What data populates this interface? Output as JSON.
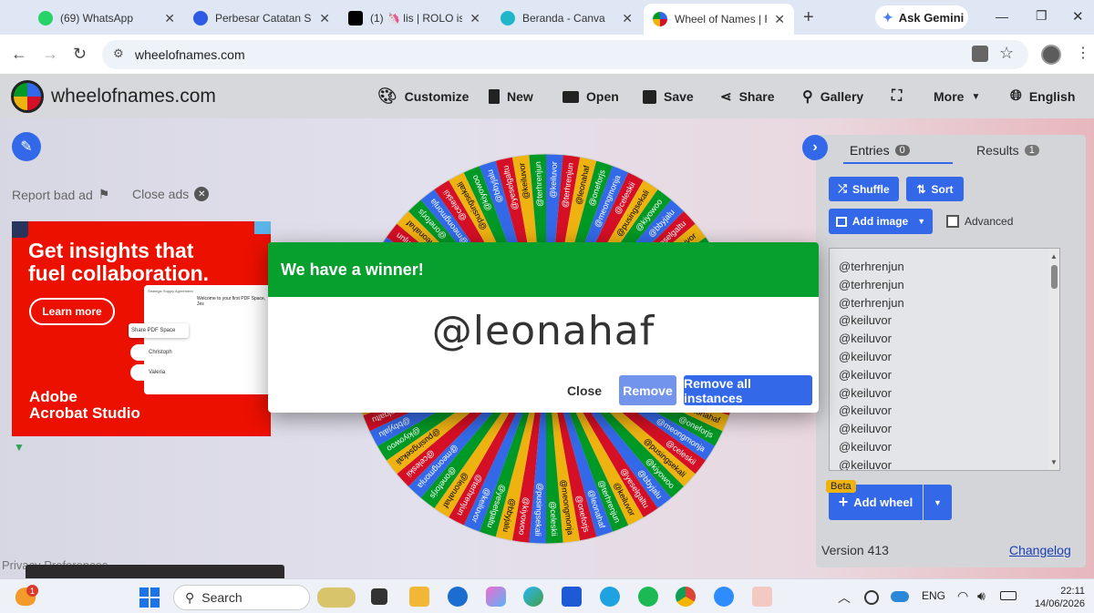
{
  "browser": {
    "tabs": [
      {
        "label": "(69) WhatsApp",
        "color": "#25d366"
      },
      {
        "label": "Perbesar Catatan Sa",
        "color": "#2d5be3"
      },
      {
        "label": "(1) 🦄 lis | ROLO is r",
        "color": "#000000"
      },
      {
        "label": "Beranda - Canva",
        "color": "#1fb6c9"
      },
      {
        "label": "Wheel of Names | R",
        "color": "#e8453c"
      }
    ],
    "new_tab": "+",
    "ask_gemini": "Ask Gemini",
    "url": "wheelofnames.com"
  },
  "site": {
    "logo_text": "wheelofnames.com",
    "menu": [
      "Customize",
      "New",
      "Open",
      "Save",
      "Share",
      "Gallery",
      "More",
      "English"
    ]
  },
  "ad": {
    "report": "Report bad ad",
    "close": "Close ads",
    "headline": "Get insights that fuel collaboration.",
    "cta": "Learn more",
    "brand_line1": "Adobe",
    "brand_line2": "Acrobat Studio",
    "doc_title": "Strategic Supply Agreement",
    "doc_heading": "Welcome to your first PDF Space, Jes",
    "share_label": "Share PDF Space",
    "person1": "Christoph",
    "person2": "Valeria",
    "privacy": "Privacy Preferences"
  },
  "wheel": {
    "segment_colors": [
      "#3369e8",
      "#d50f25",
      "#eeb211",
      "#009925"
    ],
    "labels": [
      "@keiluvor",
      "@terhrenjun",
      "@leonahaf",
      "@oneforjs",
      "@meongmonja",
      "@celeskii",
      "@pusingsekali",
      "@kiyowoo",
      "@bbyjalu",
      "@yeselgaltu"
    ]
  },
  "panel": {
    "entries_tab": "Entries",
    "entries_count": "0",
    "results_tab": "Results",
    "results_count": "1",
    "shuffle": "Shuffle",
    "sort": "Sort",
    "add_image": "Add image",
    "advanced": "Advanced",
    "entries": [
      "@terhrenjun",
      "@terhrenjun",
      "@terhrenjun",
      "@keiluvor",
      "@keiluvor",
      "@keiluvor",
      "@keiluvor",
      "@keiluvor",
      "@keiluvor",
      "@keiluvor",
      "@keiluvor",
      "@keiluvor"
    ],
    "beta": "Beta",
    "add_wheel": "Add wheel",
    "version": "Version 413",
    "changelog": "Changelog"
  },
  "modal": {
    "title": "We have a winner!",
    "winner": "@leonahaf",
    "close": "Close",
    "remove": "Remove",
    "remove_all": "Remove all instances"
  },
  "taskbar": {
    "search": "Search",
    "badge": "1",
    "lang": "ENG",
    "time": "22:11",
    "date": "14/06/2026"
  }
}
